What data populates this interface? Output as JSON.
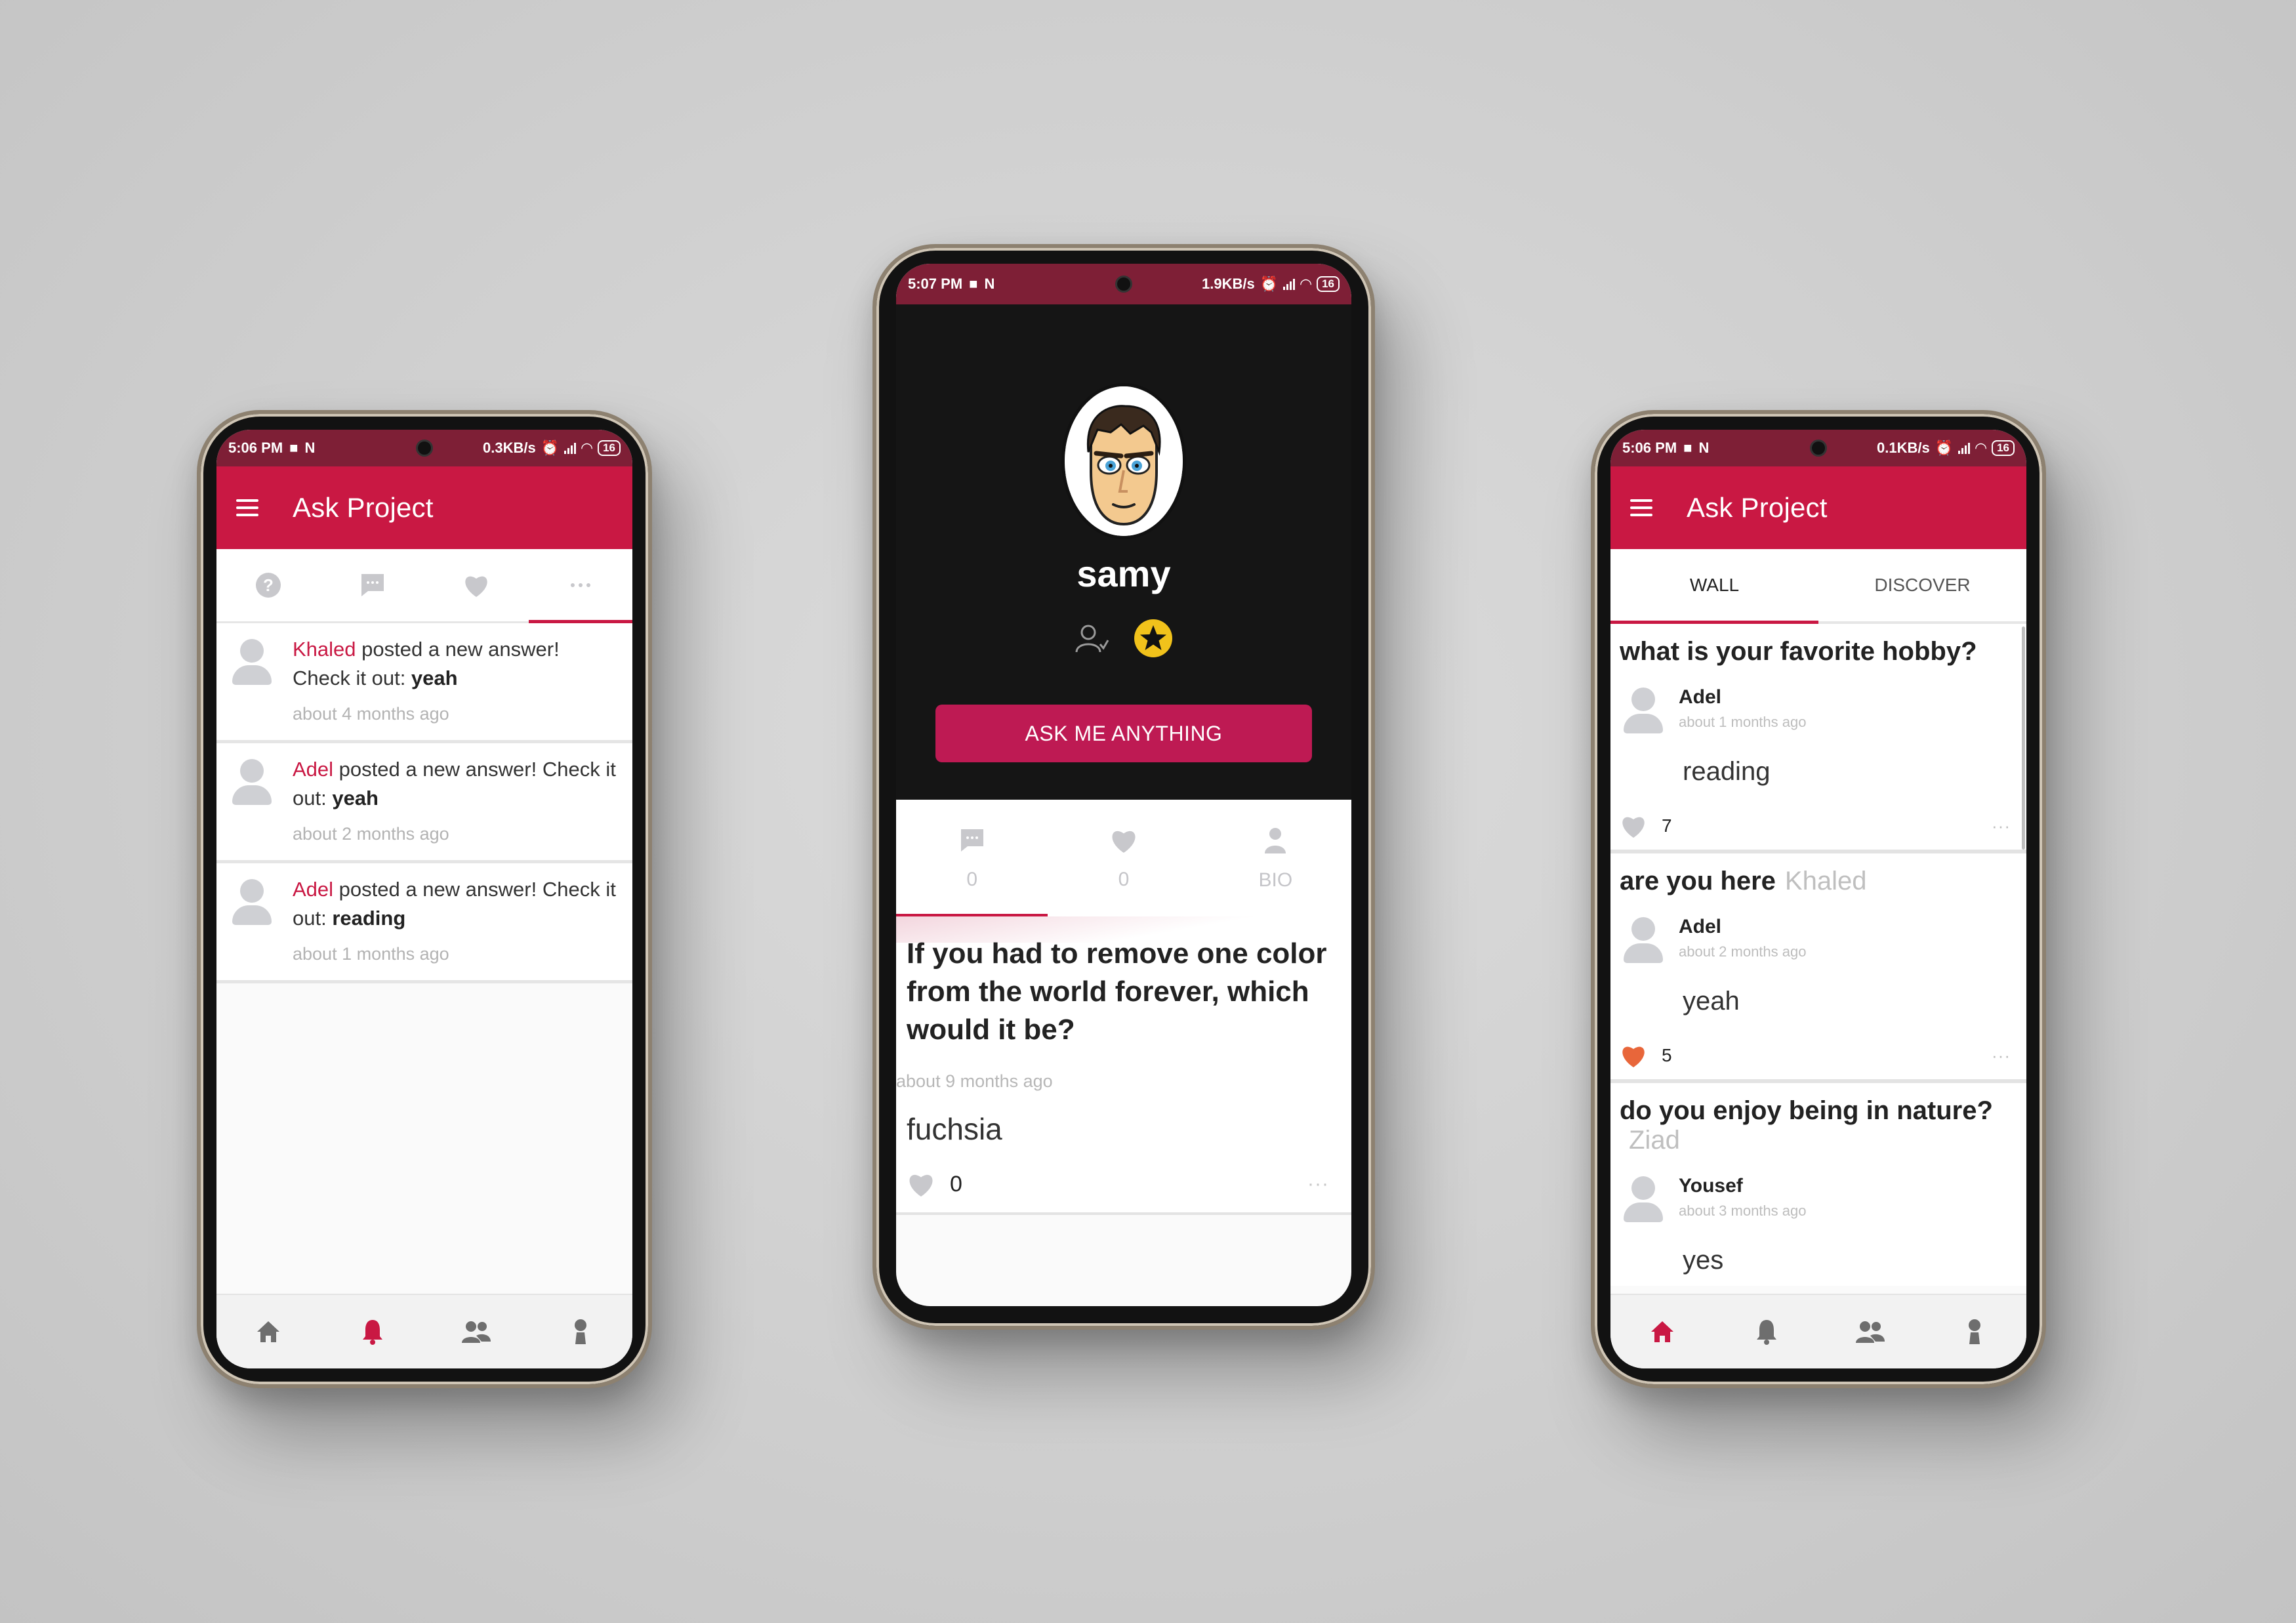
{
  "left_phone": {
    "status": {
      "time": "5:06 PM",
      "speed": "0.3KB/s",
      "battery": "16"
    },
    "app_title": "Ask Project",
    "tabs": [
      "question-icon",
      "chat-icon",
      "heart-icon",
      "more-icon"
    ],
    "active_tab_index": 3,
    "notifications": [
      {
        "name": "Khaled",
        "text": " posted a new answer! Check it out: ",
        "answer": "yeah",
        "time": "about 4 months ago"
      },
      {
        "name": "Adel",
        "text": " posted a new answer! Check it out: ",
        "answer": "yeah",
        "time": "about 2 months ago"
      },
      {
        "name": "Adel",
        "text": " posted a new answer! Check it out: ",
        "answer": "reading",
        "time": "about 1 months ago"
      }
    ],
    "bottom_nav": {
      "items": [
        "home-icon",
        "bell-icon",
        "people-icon",
        "person-icon"
      ],
      "active_index": 1
    }
  },
  "middle_phone": {
    "status": {
      "time": "5:07 PM",
      "speed": "1.9KB/s",
      "battery": "16"
    },
    "profile": {
      "name": "samy",
      "ask_button": "ASK ME ANYTHING"
    },
    "stats": [
      {
        "icon": "chat-icon",
        "label": "0"
      },
      {
        "icon": "heart-icon",
        "label": "0"
      },
      {
        "icon": "person-icon",
        "label": "BIO"
      }
    ],
    "active_stat_index": 0,
    "question": {
      "text": "If you had to remove one color from the world forever, which would it be?",
      "time": "about 9 months ago",
      "answer": "fuchsia",
      "likes": "0",
      "more": "···"
    }
  },
  "right_phone": {
    "status": {
      "time": "5:06 PM",
      "speed": "0.1KB/s",
      "battery": "16"
    },
    "app_title": "Ask Project",
    "tabs": [
      {
        "label": "WALL"
      },
      {
        "label": "DISCOVER"
      }
    ],
    "active_tab_index": 0,
    "posts": [
      {
        "question": "what is your favorite hobby?",
        "asker": "",
        "author": "Adel",
        "time": "about 1 months ago",
        "answer": "reading",
        "likes": "7",
        "liked": false
      },
      {
        "question": "are you here",
        "asker": "Khaled",
        "author": "Adel",
        "time": "about 2 months ago",
        "answer": "yeah",
        "likes": "5",
        "liked": true
      },
      {
        "question": "do you enjoy being in nature?",
        "asker": "Ziad",
        "author": "Yousef",
        "time": "about 3 months ago",
        "answer": "yes",
        "likes": "",
        "liked": false
      }
    ],
    "bottom_nav": {
      "items": [
        "home-icon",
        "bell-icon",
        "people-icon",
        "person-icon"
      ],
      "active_index": 0
    }
  },
  "colors": {
    "primary": "#c91843",
    "status_bar": "#7e1f36",
    "button": "#be1a53",
    "liked": "#e8663a",
    "inactive_icon": "#c8c8cc"
  }
}
